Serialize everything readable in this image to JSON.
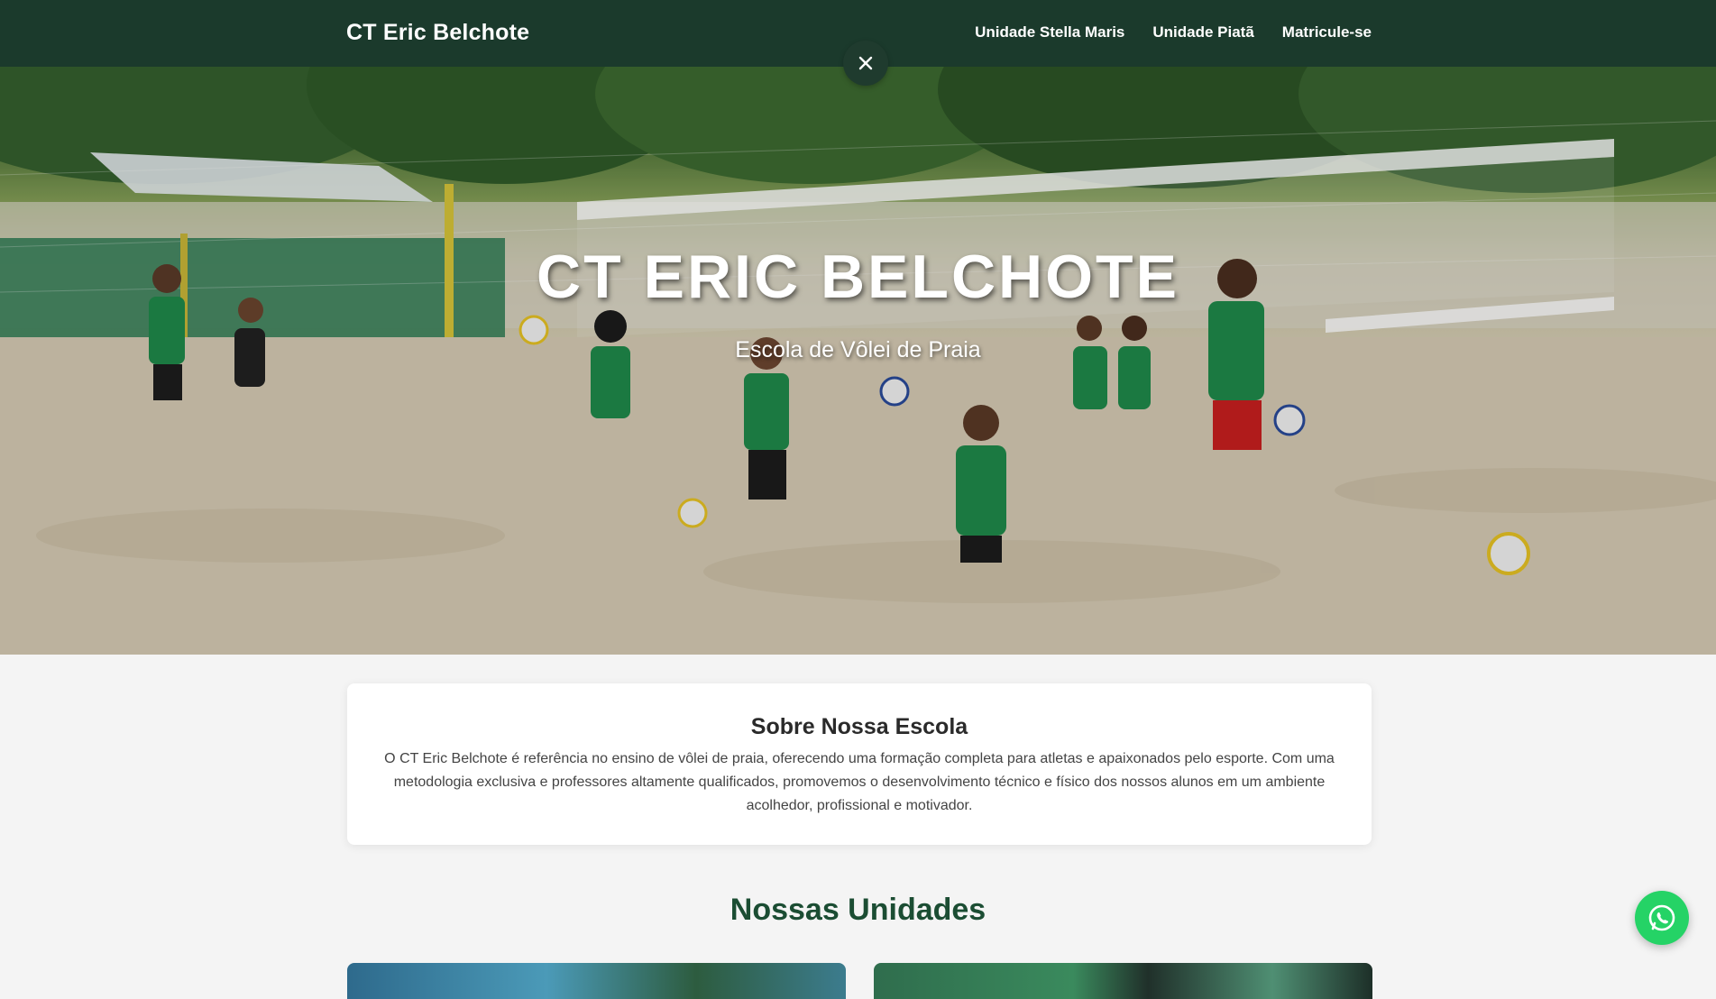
{
  "navbar": {
    "brand": "CT Eric Belchote",
    "links": [
      {
        "label": "Unidade Stella Maris"
      },
      {
        "label": "Unidade Piatã"
      },
      {
        "label": "Matricule-se"
      }
    ]
  },
  "hero": {
    "title": "CT ERIC BELCHOTE",
    "subtitle": "Escola de Vôlei de Praia",
    "net_banner_text": "CT ERIC BELCHOTE"
  },
  "about": {
    "title": "Sobre Nossa Escola",
    "text": "O CT Eric Belchote é referência no ensino de vôlei de praia, oferecendo uma formação completa para atletas e apaixonados pelo esporte. Com uma metodologia exclusiva e professores altamente qualificados, promovemos o desenvolvimento técnico e físico dos nossos alunos em um ambiente acolhedor, profissional e motivador."
  },
  "units": {
    "title": "Nossas Unidades"
  },
  "icons": {
    "close": "close-icon",
    "whatsapp": "whatsapp-icon"
  },
  "colors": {
    "navbar_bg": "#1b3a2c",
    "accent_green": "#1b4d33",
    "whatsapp": "#25d366"
  }
}
